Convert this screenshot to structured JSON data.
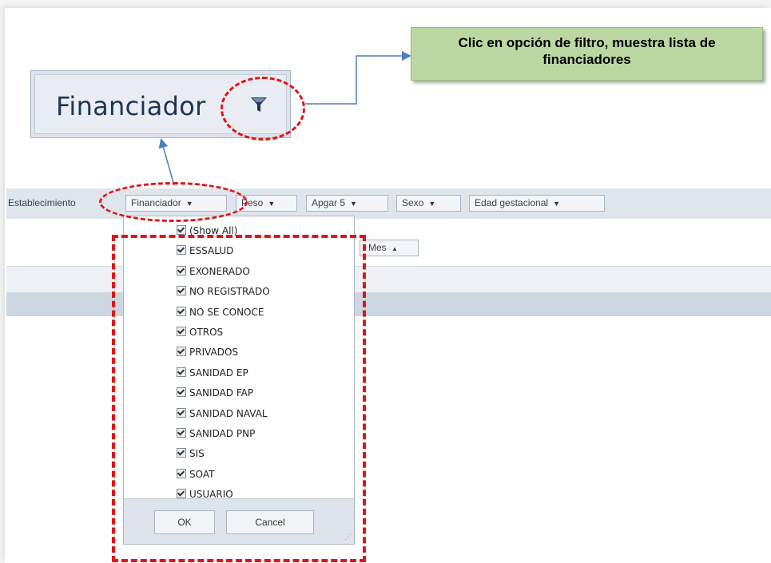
{
  "zoom": {
    "label": "Financiador",
    "icon": "funnel-icon"
  },
  "callout": {
    "line1": "Clic en opción de filtro, muestra lista de",
    "line2": "financiadores"
  },
  "toolbar": {
    "establecimiento": "Establecimiento",
    "financiador": "Financiador",
    "peso": "Peso",
    "apgar": "Apgar 5",
    "sexo": "Sexo",
    "edad": "Edad gestacional",
    "arrow": "▼"
  },
  "mes": {
    "label": "Mes",
    "sort": "▲"
  },
  "dropdown": {
    "items": [
      "(Show All)",
      "ESSALUD",
      "EXONERADO",
      "NO REGISTRADO",
      "NO SE CONOCE",
      "OTROS",
      "PRIVADOS",
      "SANIDAD EP",
      "SANIDAD FAP",
      "SANIDAD NAVAL",
      "SANIDAD PNP",
      "SIS",
      "SOAT",
      "USUARIO"
    ],
    "ok_label": "OK",
    "cancel_label": "Cancel"
  },
  "colors": {
    "annotation_red": "#e01515",
    "callout_green": "#bcd8a2",
    "arrow_blue": "#4a7fc1"
  }
}
